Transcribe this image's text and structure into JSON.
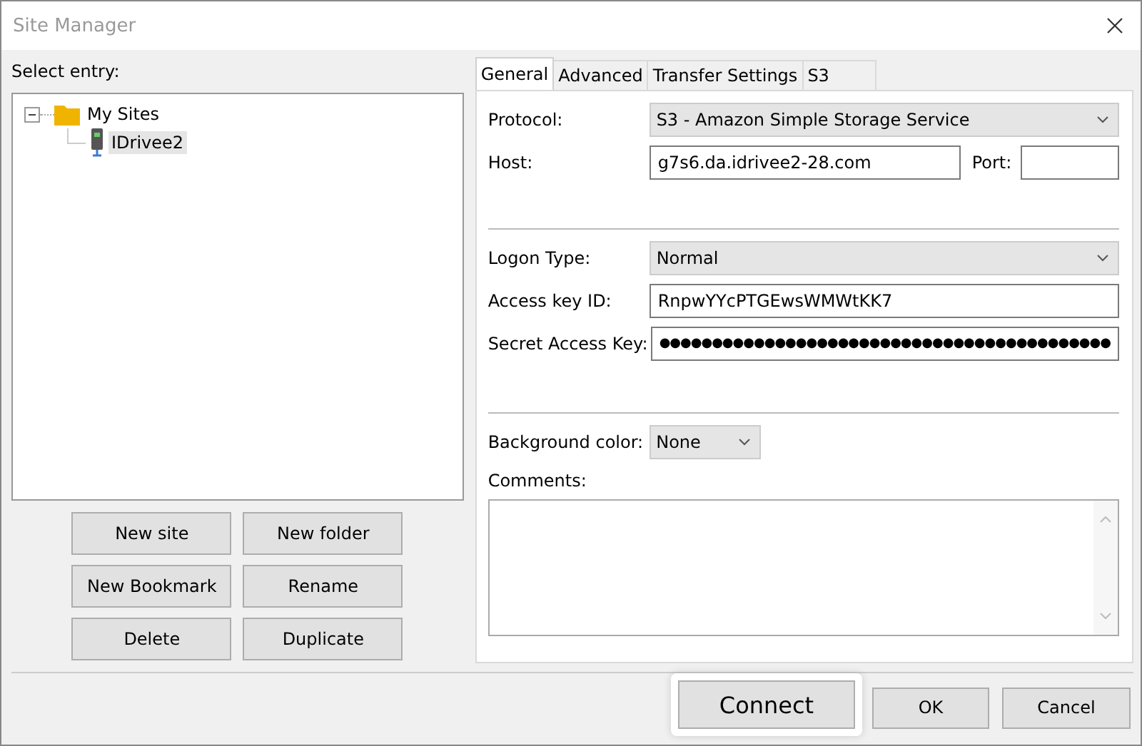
{
  "window": {
    "title": "Site Manager"
  },
  "select_label": "Select entry:",
  "tree": [
    {
      "label": "My Sites",
      "kind": "folder",
      "expanded": true,
      "selected": false,
      "children": [
        {
          "label": "IDrivee2",
          "kind": "site",
          "selected": true
        }
      ]
    }
  ],
  "left_buttons": [
    "New site",
    "New folder",
    "New Bookmark",
    "Rename",
    "Delete",
    "Duplicate"
  ],
  "tabs": [
    {
      "label": "General",
      "selected": true
    },
    {
      "label": "Advanced",
      "selected": false
    },
    {
      "label": "Transfer Settings",
      "selected": false
    },
    {
      "label": "S3",
      "selected": false
    }
  ],
  "protocol": {
    "label": "Protocol:",
    "value": "S3 - Amazon Simple Storage Service"
  },
  "host": {
    "label": "Host:",
    "value": "g7s6.da.idrivee2-28.com"
  },
  "port": {
    "label": "Port:"
  },
  "logon_type": {
    "label": "Logon Type:",
    "value": "Normal"
  },
  "access_key": {
    "label": "Access key ID:",
    "value": "RnpwYYcPTGEwsWMWtKK7"
  },
  "secret_key": {
    "label": "Secret Access Key:",
    "value": "●●●●●●●●●●●●●●●●●●●●●●●●●●●●●●●●●●●●●●●●●●●"
  },
  "background_color": {
    "label": "Background color:",
    "value": "None"
  },
  "comments": {
    "label": "Comments:"
  },
  "footer_buttons": [
    {
      "label": "Connect",
      "highlighted": true
    },
    {
      "label": "OK",
      "highlighted": false
    },
    {
      "label": "Cancel",
      "highlighted": false
    }
  ]
}
